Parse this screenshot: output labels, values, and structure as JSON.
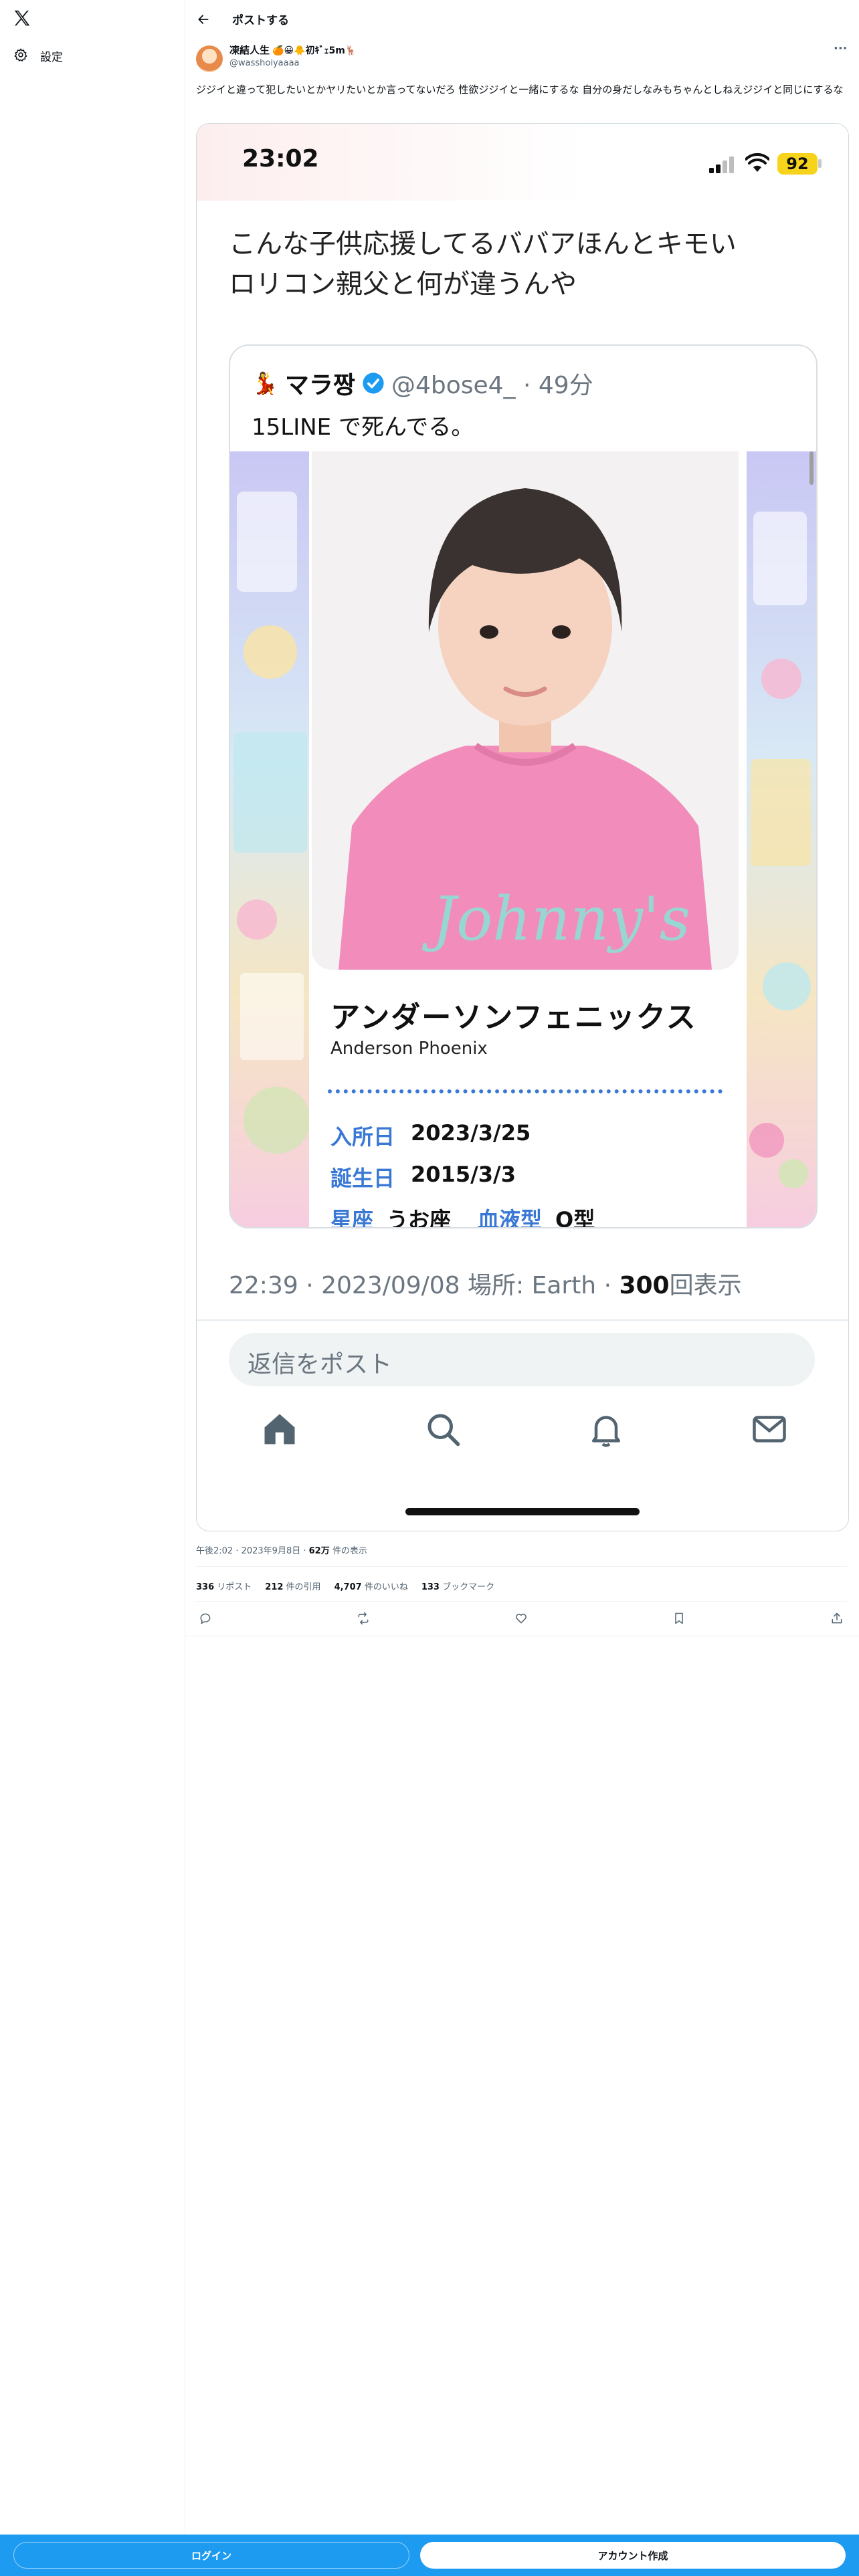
{
  "sidebar": {
    "logo_icon": "x-logo-icon",
    "settings_label": "設定"
  },
  "header": {
    "title": "ポストする"
  },
  "post": {
    "author_name": "凍結人生",
    "author_suffix": "🍊😀🐥初ｷﾞｪ5m🦌",
    "handle": "@wasshoiyaaaa",
    "more": "···",
    "text": "ジジイと違って犯したいとかヤリたいとか言ってないだろ 性欲ジジイと一緒にするな 自分の身だしなみもちゃんとしねえジジイと同じにするな",
    "meta_time": "午後2:02 · 2023年9月8日 · ",
    "meta_views_num": "62万",
    "meta_views_label": " 件の表示",
    "stats": [
      {
        "num": "336",
        "label": " リポスト"
      },
      {
        "num": "212",
        "label": " 件の引用"
      },
      {
        "num": "4,707",
        "label": " 件のいいね"
      },
      {
        "num": "133",
        "label": " ブックマーク"
      }
    ]
  },
  "screenshot": {
    "clock": "23:02",
    "battery": "92",
    "body_line1": "こんな子供応援してるババアほんとキモい",
    "body_line2": "ロリコン親父と何が違うんや",
    "quote_emoji": "💃",
    "quote_name": "マラ짱",
    "quote_handle": "@4bose4_ · 49分",
    "quote_text": "15LINE で死んでる。",
    "profile_name_jp": "アンダーソンフェニックス",
    "profile_name_en": "Anderson Phoenix",
    "row1_label": "入所日",
    "row1_value": "2023/3/25",
    "row2_label": "誕生日",
    "row2_value": "2015/3/3",
    "row3_label": "星座",
    "row3_value": "うお座",
    "row3b_label": "血液型",
    "row3b_value": "O型",
    "tshirt_text": "Johnny's",
    "footer_meta": "22:39 · 2023/09/08 場所: Earth · ",
    "footer_views": "300",
    "footer_views_label": "回表示",
    "reply_placeholder": "返信をポスト"
  },
  "footer": {
    "login": "ログイン",
    "signup": "アカウント作成"
  },
  "colors": {
    "accent": "#1d9bf0",
    "tshirt": "#f28dbb",
    "label_blue": "#3a78d6",
    "battery": "#f7d31b"
  }
}
